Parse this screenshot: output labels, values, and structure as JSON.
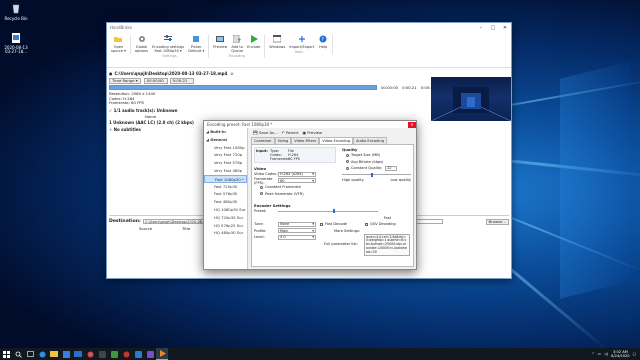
{
  "desktop": {
    "recycle_bin": "Recycle Bin",
    "file_icon_label": "2020-08-13\n03-27-18..."
  },
  "window": {
    "title": "HandBrake"
  },
  "toolbar": {
    "groups": [
      {
        "label": "",
        "items": [
          {
            "label": "Open\nsource ▾",
            "icon": "folder-open-icon"
          }
        ]
      },
      {
        "label": "Settings",
        "items": [
          {
            "label": "Global\noptions",
            "icon": "gear-icon"
          },
          {
            "label": "Encoding settings\nFast 1080p30 ▾",
            "icon": "sliders-icon"
          },
          {
            "label": "Picker\nDefault ▾",
            "icon": "picker-icon"
          }
        ]
      },
      {
        "label": "Encoding",
        "items": [
          {
            "label": "Preview",
            "icon": "preview-icon"
          },
          {
            "label": "Add to\nQueue",
            "icon": "add-queue-icon"
          },
          {
            "label": "Encode",
            "icon": "play-icon"
          }
        ]
      },
      {
        "label": "Tools",
        "items": [
          {
            "label": "Windows",
            "icon": "windows-icon"
          },
          {
            "label": "Import/Export",
            "icon": "import-export-icon"
          },
          {
            "label": "Help",
            "icon": "help-icon"
          }
        ]
      }
    ]
  },
  "source": {
    "path": "C:\\Users\\qnpjh\\Desktop\\2020-08-13 03-27-18.mp4",
    "time_range": "Time Range",
    "start_time": "00:00:00",
    "end_time": "0:00:21",
    "resolution": "Resolution: 2560 x 1440",
    "codec": "Codec: H.264",
    "framerate": "Framerate: 60 FPS",
    "audio": "1/1 audio track(s): Unknown",
    "subtitles": "No subtitles",
    "range_end": "0:00:21"
  },
  "tracks": {
    "name_header": "Name",
    "row": "1 Unknown (AAC LC) (2.0 ch) (2 kbps)"
  },
  "destination": {
    "label": "Destination:",
    "path": "C:\\Users\\qnpjh\\Desktop\\2020-08-13 03-27-18.mp4",
    "browse": "Browse...",
    "col_source": "Source",
    "col_title": "Title"
  },
  "dialog": {
    "title": "Encoding preset: Fast 1080p30 *",
    "toolbar": [
      "Save As...",
      "Revert",
      "Preview"
    ],
    "tabs": [
      "Container",
      "Sizing",
      "Video Filters",
      "Video Encoding",
      "Audio Encoding"
    ],
    "active_tab": "Video Encoding",
    "presets": [
      {
        "label": "Built-in",
        "header": true
      },
      {
        "label": "General",
        "header": true
      },
      {
        "label": "Very Fast 1080p"
      },
      {
        "label": "Very Fast 720p"
      },
      {
        "label": "Very Fast 576p"
      },
      {
        "label": "Very Fast 480p"
      },
      {
        "label": "Fast 1080p30 *",
        "selected": true
      },
      {
        "label": "Fast 720p30"
      },
      {
        "label": "Fast 576p30"
      },
      {
        "label": "Fast 480p30"
      },
      {
        "label": "HQ 1080p30 Sur"
      },
      {
        "label": "HQ 720p30 Sur"
      },
      {
        "label": "HQ 576p25 Sur"
      },
      {
        "label": "HQ 480p30 Sur"
      }
    ],
    "input": {
      "k1": "Input:",
      "type_k": "Type:",
      "type_v": "File",
      "codec_k": "Codec:",
      "codec_v": "H.264",
      "fr_k": "Framerate:",
      "fr_v": "60 FPS"
    },
    "video": {
      "header": "Video",
      "codec_label": "Video Codec:",
      "codec_value": "H.264 (x264)",
      "framerate_label": "Framerate (FPS):",
      "framerate_value": "60",
      "constant": "Constant Framerate",
      "peak": "Peak framerate (VFR)"
    },
    "quality": {
      "header": "Quality",
      "target": "Target Size (MB)",
      "avg": "Avg Bitrate (kbps)",
      "cq": "Constant Quality:",
      "cq_value": "22",
      "high": "High quality",
      "low": "Low quality"
    },
    "encoder": {
      "header": "Encoder Settings",
      "preset": "Preset:",
      "fast": "Fast",
      "tune": "Tune:",
      "tune_value": "None",
      "fast_decode": "Fast Decode",
      "qsv": "QSV Decoding",
      "profile": "Profile:",
      "profile_value": "Main",
      "more": "More Settings:",
      "level": "Level:",
      "level_value": "4.0",
      "full_param": "Full parameter list:",
      "param_text": "level=4.0:ref=2:8x8dct=0:weightp=1:subme=6:vbv-bufsize=25000:vbv-maxrate=20000:rc-lookahead=30"
    }
  },
  "taskbar": {
    "time": "3:02 AM",
    "date": "8/24/2020"
  }
}
